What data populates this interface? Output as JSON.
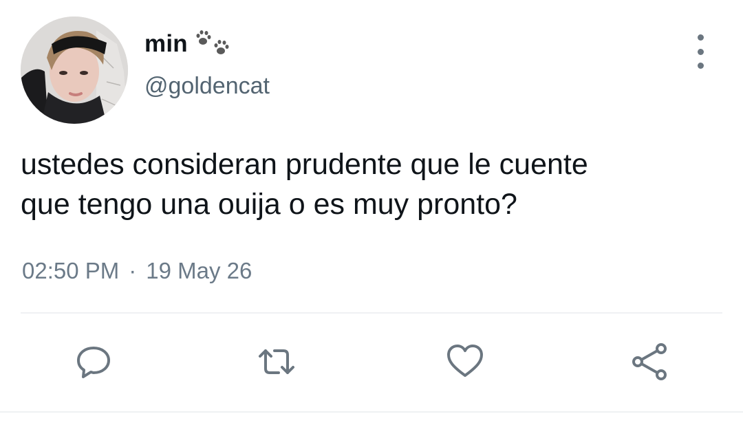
{
  "user": {
    "display_name": "min",
    "handle": "@goldencat",
    "name_emoji_icon": "paw-prints-icon",
    "avatar_icon": "avatar-photo"
  },
  "tweet": {
    "text_line_1": "ustedes consideran prudente que le cuente",
    "text_line_2": "que tengo una ouija o es muy pronto?",
    "time": "02:50 PM",
    "separator": "·",
    "date": "19 May 26"
  },
  "actions": [
    {
      "name": "reply",
      "icon": "reply-icon"
    },
    {
      "name": "retweet",
      "icon": "retweet-icon"
    },
    {
      "name": "like",
      "icon": "heart-icon"
    },
    {
      "name": "share",
      "icon": "share-icon"
    }
  ],
  "colors": {
    "text_primary": "#0f1419",
    "text_secondary": "#536471",
    "icon_gray": "#6b7680",
    "divider": "#eff1f3"
  }
}
